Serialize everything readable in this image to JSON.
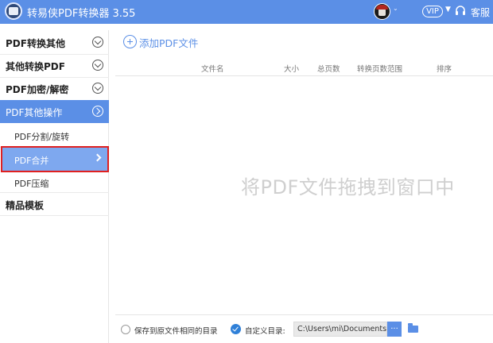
{
  "app": {
    "title": "转易侠PDF转换器 3.55",
    "vip_label": "VIP",
    "support_label": "客服",
    "accent_color": "#5b8fe6"
  },
  "sidebar": {
    "sections": [
      {
        "label": "PDF转换其他",
        "expanded": false
      },
      {
        "label": "其他转换PDF",
        "expanded": false
      },
      {
        "label": "PDF加密/解密",
        "expanded": false
      },
      {
        "label": "PDF其他操作",
        "expanded": true
      }
    ],
    "sub_items": [
      {
        "label": "PDF分割/旋转"
      },
      {
        "label": "PDF合并",
        "selected": true
      },
      {
        "label": "PDF压缩"
      }
    ],
    "extra_section": {
      "label": "精品模板"
    }
  },
  "main": {
    "add_button_label": "添加PDF文件",
    "columns": [
      "文件名",
      "大小",
      "总页数",
      "转换页数范围",
      "排序"
    ],
    "drop_hint": "将PDF文件拖拽到窗口中"
  },
  "footer": {
    "save_same_dir_label": "保存到原文件相同的目录",
    "save_same_dir_checked": false,
    "custom_dir_label": "自定义目录:",
    "custom_dir_checked": true,
    "path_value": "C:\\Users\\mi\\Documents...",
    "browse_label": "..."
  }
}
